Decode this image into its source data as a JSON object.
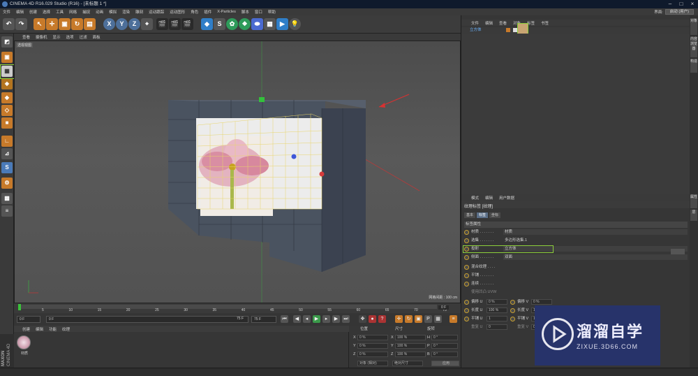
{
  "titlebar": {
    "title": "CINEMA 4D R16.029 Studio (R16) - [未标题 1 *]"
  },
  "menubar": {
    "items": [
      "文件",
      "编辑",
      "创建",
      "选择",
      "工具",
      "网格",
      "捕捉",
      "动画",
      "模拟",
      "渲染",
      "雕刻",
      "运动跟踪",
      "运动图形",
      "角色",
      "插件",
      "X-Particles",
      "脚本",
      "窗口",
      "帮助"
    ]
  },
  "layout": {
    "label": "界面:",
    "value": "启动 (用户)"
  },
  "toolbar": {
    "axis_x": "X",
    "axis_y": "Y",
    "axis_z": "Z"
  },
  "viewport": {
    "menu": [
      "查看",
      "摄像机",
      "显示",
      "选项",
      "过滤",
      "面板"
    ],
    "label": "透视视图",
    "grid": "网格间距 : 100 cm"
  },
  "timeline": {
    "ticks": [
      "0",
      "5",
      "10",
      "15",
      "20",
      "25",
      "30",
      "35",
      "40",
      "45",
      "50",
      "55",
      "60",
      "65",
      "70",
      "75"
    ],
    "end": "0 F"
  },
  "timecontrol": {
    "start": "0 F",
    "current": "0 F",
    "range_end": "75 F",
    "end": "75 F"
  },
  "materials": {
    "menu": [
      "创建",
      "编辑",
      "功能",
      "纹理"
    ],
    "item": "材质"
  },
  "coords": {
    "pos": "位置",
    "size": "尺寸",
    "rot": "旋转",
    "x": "X",
    "y": "Y",
    "z": "Z",
    "h": "H",
    "p": "P",
    "b": "B",
    "xv": "0 %",
    "yv": "0 %",
    "zv": "0 %",
    "sx": "100 %",
    "sy": "100 %",
    "sz": "100 %",
    "hv": "0 °",
    "pv": "0 °",
    "bv": "0 °",
    "mode": "对象 (相对)",
    "size_mode": "绝对尺寸",
    "apply": "应用"
  },
  "objects": {
    "menu": [
      "文件",
      "编辑",
      "查看",
      "对象",
      "标签",
      "书签"
    ],
    "name": "立方体"
  },
  "attributes": {
    "menu": [
      "模式",
      "编辑",
      "用户数据"
    ],
    "title": "纹理标签 [纹理]",
    "tabs": [
      "基本",
      "标签",
      "坐标"
    ],
    "section": "标签属性",
    "rows": [
      {
        "label": "材质 . . . . . . .",
        "value": "材质"
      },
      {
        "label": "选集 . . . . . . .",
        "value": "多边形选集.1"
      },
      {
        "label": "投射",
        "value": "立方体"
      },
      {
        "label": "侧面 . . . . . . .",
        "value": "双面"
      },
      {
        "label": "混合纹理 . . . .",
        "value": ""
      },
      {
        "label": "平铺 . . . . . . .",
        "value": ""
      },
      {
        "label": "连续 . . . . . . .",
        "value": ""
      },
      {
        "label": "使用凹凸 UVW",
        "value": ""
      }
    ],
    "offset_u": "偏移 U",
    "offset_u_v": "0 %",
    "offset_v": "偏移 V",
    "offset_v_v": "0 %",
    "len_u": "长度 U",
    "len_u_v": "100 %",
    "len_v": "长度 V",
    "len_v_v": "10",
    "tile_u": "平铺 U",
    "tile_u_v": "1",
    "tile_v": "平铺 V",
    "tile_v_v": "1",
    "rep_u": "重复 U",
    "rep_u_v": "0",
    "rep_v": "重复 V",
    "rep_v_v": "0"
  },
  "rightstrip": {
    "tabs": [
      "对象",
      "内容浏览器",
      "构造",
      "属性",
      "层"
    ]
  },
  "brand": {
    "name": "溜溜自学",
    "url": "ZIXUE.3D66.COM"
  },
  "maxon": {
    "line1": "MAXON",
    "line2": "CINEMA 4D"
  }
}
